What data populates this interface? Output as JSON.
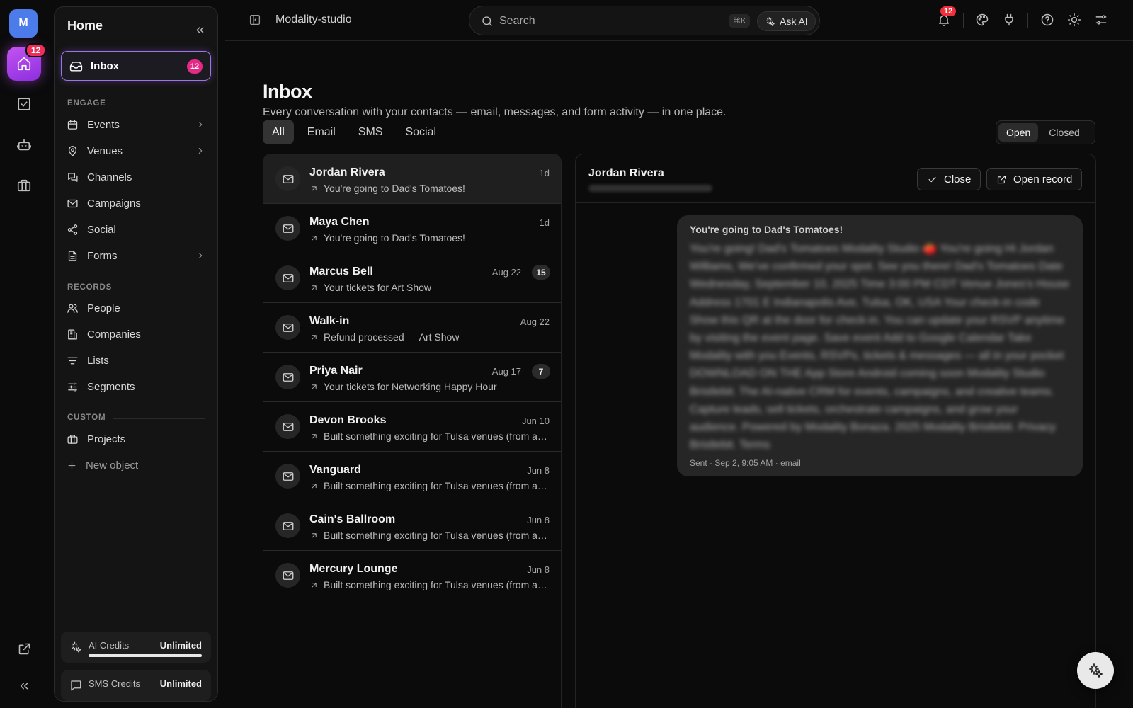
{
  "rail": {
    "avatar_letter": "M",
    "home_badge": "12"
  },
  "sidebar": {
    "title": "Home",
    "inbox": {
      "label": "Inbox",
      "badge": "12"
    },
    "sections": {
      "engage": "ENGAGE",
      "records": "RECORDS",
      "custom": "CUSTOM"
    },
    "engage_items": [
      {
        "label": "Events",
        "icon": "calendar-icon",
        "has_chevron": true
      },
      {
        "label": "Venues",
        "icon": "map-pin-icon",
        "has_chevron": true
      },
      {
        "label": "Channels",
        "icon": "chat-bubbles-icon",
        "has_chevron": false
      },
      {
        "label": "Campaigns",
        "icon": "mail-icon",
        "has_chevron": false
      },
      {
        "label": "Social",
        "icon": "share-icon",
        "has_chevron": false
      },
      {
        "label": "Forms",
        "icon": "document-icon",
        "has_chevron": true
      }
    ],
    "records_items": [
      {
        "label": "People",
        "icon": "users-icon"
      },
      {
        "label": "Companies",
        "icon": "building-icon"
      },
      {
        "label": "Lists",
        "icon": "list-icon"
      },
      {
        "label": "Segments",
        "icon": "sliders-icon"
      }
    ],
    "custom_items": [
      {
        "label": "Projects",
        "icon": "briefcase-icon"
      }
    ],
    "new_object": "New object",
    "credits": [
      {
        "name": "AI Credits",
        "value": "Unlimited",
        "fill": 1.0
      },
      {
        "name": "SMS Credits",
        "value": "Unlimited"
      }
    ]
  },
  "topbar": {
    "breadcrumb": "Modality-studio",
    "search_placeholder": "Search",
    "search_shortcut": "⌘K",
    "ask_ai": "Ask AI",
    "notification_badge": "12"
  },
  "main": {
    "title": "Inbox",
    "subtitle": "Every conversation with your contacts — email, messages, and form activity — in one place.",
    "tabs": [
      "All",
      "Email",
      "SMS",
      "Social"
    ],
    "active_tab": "All",
    "status_toggle": [
      "Open",
      "Closed"
    ],
    "active_status": "Open"
  },
  "conversations": [
    {
      "name": "Jordan Rivera",
      "date": "1d",
      "snippet": "You're going to Dad's Tomatoes!",
      "count": ""
    },
    {
      "name": "Maya Chen",
      "date": "1d",
      "snippet": "You're going to Dad's Tomatoes!",
      "count": ""
    },
    {
      "name": "Marcus Bell",
      "date": "Aug 22",
      "snippet": "Your tickets for Art Show",
      "count": "15"
    },
    {
      "name": "Walk-in",
      "date": "Aug 22",
      "snippet": "Refund processed — Art Show",
      "count": ""
    },
    {
      "name": "Priya Nair",
      "date": "Aug 17",
      "snippet": "Your tickets for Networking Happy Hour",
      "count": "7"
    },
    {
      "name": "Devon Brooks",
      "date": "Jun 10",
      "snippet": "Built something exciting for Tulsa venues (from a…",
      "count": ""
    },
    {
      "name": "Vanguard",
      "date": "Jun 8",
      "snippet": "Built something exciting for Tulsa venues (from a…",
      "count": ""
    },
    {
      "name": "Cain's Ballroom",
      "date": "Jun 8",
      "snippet": "Built something exciting for Tulsa venues (from a…",
      "count": ""
    },
    {
      "name": "Mercury Lounge",
      "date": "Jun 8",
      "snippet": "Built something exciting for Tulsa venues (from a…",
      "count": ""
    }
  ],
  "detail": {
    "name": "Jordan Rivera",
    "close_label": "Close",
    "open_record_label": "Open record",
    "message": {
      "subject": "You're going to Dad's Tomatoes!",
      "body": "You're going! Dad's Tomatoes Modality Studio 🍅 You're going Hi Jordan Williams, We've confirmed your spot. See you there! Dad's Tomatoes Date Wednesday, September 10, 2025 Time 3:00 PM CDT Venue Jones's House Address 1701 E Indianapolis Ave, Tulsa, OK, USA Your check-in code Show this QR at the door for check-in. You can update your RSVP anytime by visiting the event page. Save event Add to Google Calendar Take Modality with you Events, RSVPs, tickets & messages — all in your pocket DOWNLOAD ON THE App Store Android coming soon Modality Studio Bristlebit. The AI-native CRM for events, campaigns, and creative teams. Capture leads, sell tickets, orchestrate campaigns, and grow your audience. Powered by Modality Bonaza. 2025 Modality Bristlebit. Privacy Bristlebit. Terms",
      "meta": "Sent · Sep 2, 9:05 AM · email"
    }
  }
}
